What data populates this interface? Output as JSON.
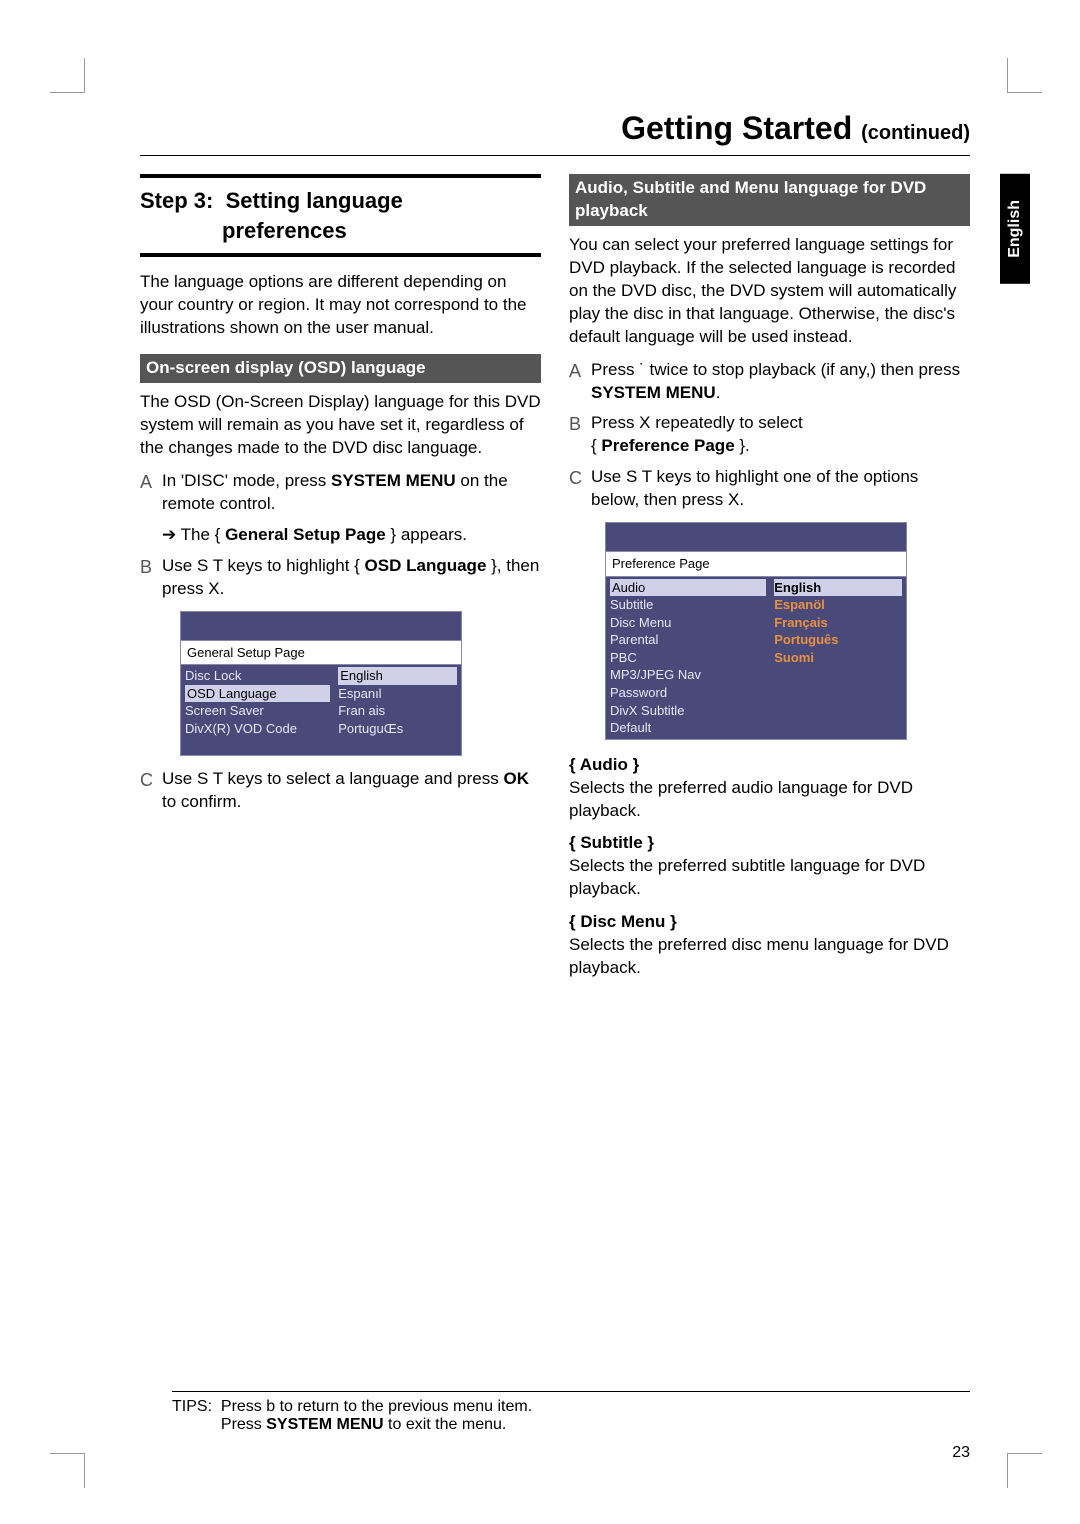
{
  "header": {
    "title": "Getting Started",
    "continued": "(continued)"
  },
  "language_tab": "English",
  "left": {
    "step_title_a": "Step 3:",
    "step_title_b": "Setting language",
    "step_title_c": "preferences",
    "intro": "The language options are different depending on your country or region. It may not correspond to the illustrations shown on the user manual.",
    "osd_heading": "On-screen display (OSD) language",
    "osd_para": "The OSD (On-Screen Display) language for this DVD system will remain as you have set it, regardless of the changes made to the DVD disc language.",
    "stepA_pre": "In 'DISC' mode, press ",
    "stepA_bold": "SYSTEM MENU",
    "stepA_post": " on the remote control.",
    "stepA_arrow_pre": "➔ The { ",
    "stepA_arrow_bold": "General Setup Page",
    "stepA_arrow_post": " } appears.",
    "stepB_pre": "Use  S T  keys to highlight  { ",
    "stepB_bold": "OSD Language",
    "stepB_post": " }, then press  X.",
    "stepC_pre": "Use  S T  keys to select a language and press ",
    "stepC_bold": "OK",
    "stepC_post": " to confirm.",
    "menu1": {
      "title": "General Setup Page",
      "left_items": [
        "Disc Lock",
        "OSD Language",
        "Screen Saver",
        "DivX(R) VOD Code"
      ],
      "right_items": [
        "English",
        "Espanıl",
        "Fran ais",
        "PortuguŒs"
      ]
    }
  },
  "right": {
    "sub_heading": "Audio, Subtitle and Menu language for DVD playback",
    "intro": "You can select your preferred language settings for DVD playback.  If the selected language is recorded on the DVD disc, the DVD system will automatically play the disc in that language.  Otherwise, the disc's default language will be used instead.",
    "stepA_pre": "Press  ˙  twice to stop playback (if any,) then press ",
    "stepA_bold": "SYSTEM MENU",
    "stepA_post": ".",
    "stepB_pre": "Press  X repeatedly to select ",
    "stepB_brace_open": "{ ",
    "stepB_bold": "Preference Page",
    "stepB_brace_close": " }.",
    "stepC": "Use  S T  keys to highlight one of the options below, then press  X.",
    "menu2": {
      "title": "Preference Page",
      "left_items": [
        "Audio",
        "Subtitle",
        "Disc Menu",
        "Parental",
        "PBC",
        "MP3/JPEG Nav",
        "Password",
        "DivX Subtitle",
        "Default"
      ],
      "right_items": [
        "English",
        "Espanöl",
        "Français",
        "Português",
        "Suomi"
      ]
    },
    "audio_label": "{ Audio }",
    "audio_text": "Selects the preferred audio language for DVD playback.",
    "subtitle_label": "{ Subtitle }",
    "subtitle_text": "Selects the preferred subtitle language for DVD playback.",
    "discmenu_label": "{ Disc Menu }",
    "discmenu_text": "Selects the preferred disc menu language for DVD playback."
  },
  "tips": {
    "label": "TIPS:",
    "line1_pre": "Press b  to return to the previous menu item.",
    "line2_pre": "Press ",
    "line2_bold": "SYSTEM MENU",
    "line2_post": " to exit the menu."
  },
  "page_number": "23"
}
